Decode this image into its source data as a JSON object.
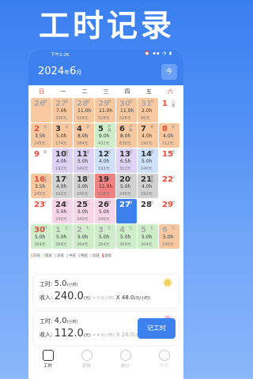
{
  "banner": "工时记录",
  "status": {
    "time": "下午2:26",
    "icons": "⏰ ▪▪ ◔ ▮"
  },
  "header": {
    "year": "2024",
    "year_suffix": "年",
    "month": "6",
    "month_suffix": "月",
    "today_button": "今"
  },
  "weekdays": [
    "日",
    "一",
    "二",
    "三",
    "四",
    "五",
    "六"
  ],
  "days": [
    {
      "d": "26",
      "l": "廿",
      "h": "",
      "w": "",
      "bg": "orange",
      "muted": true
    },
    {
      "d": "27",
      "l": "廿",
      "h": "7.0h",
      "w": "336元",
      "bg": "orange",
      "muted": true
    },
    {
      "d": "28",
      "l": "廿",
      "h": "11.0h",
      "w": "528元",
      "bg": "orange",
      "muted": true
    },
    {
      "d": "29",
      "l": "廿",
      "h": "11.0h",
      "w": "528元",
      "bg": "orange",
      "muted": true
    },
    {
      "d": "30",
      "l": "廿",
      "h": "11.0h",
      "w": "528元",
      "bg": "orange",
      "muted": true
    },
    {
      "d": "31",
      "l": "廿",
      "h": "2.0h",
      "w": "96元",
      "bg": "orange",
      "muted": true
    },
    {
      "d": "1",
      "l": "儿童",
      "h": "",
      "w": "",
      "bg": "none"
    },
    {
      "d": "2",
      "l": "廿",
      "h": "3.5h",
      "w": "245元",
      "bg": "orange"
    },
    {
      "d": "3",
      "l": "廿",
      "h": "5.0h",
      "w": "174元",
      "bg": "orange"
    },
    {
      "d": "4",
      "l": "廿",
      "h": "8.0h",
      "w": "384元",
      "bg": "orange"
    },
    {
      "d": "5",
      "l": "芒种",
      "h": "9.0h",
      "w": "432元",
      "bg": "green"
    },
    {
      "d": "6",
      "l": "芒种",
      "h": "8.0h",
      "w": "630元",
      "bg": "orange"
    },
    {
      "d": "7",
      "l": "初",
      "h": "4.0h",
      "w": "192元",
      "bg": "orange"
    },
    {
      "d": "8",
      "l": "初",
      "h": "4.0h",
      "w": "112元",
      "bg": "orange"
    },
    {
      "d": "9",
      "l": "初",
      "h": "",
      "w": "",
      "bg": "none"
    },
    {
      "d": "10",
      "l": "端午",
      "h": "4.0h",
      "w": "192元",
      "bg": "purple"
    },
    {
      "d": "11",
      "l": "初",
      "h": "5.0h",
      "w": "240元",
      "bg": "purple"
    },
    {
      "d": "12",
      "l": "初",
      "h": "4.0h",
      "w": "192元",
      "bg": "blue"
    },
    {
      "d": "13",
      "l": "初",
      "h": "6.5h",
      "w": "312元",
      "bg": "purple"
    },
    {
      "d": "14",
      "l": "初",
      "h": "5.0h",
      "w": "240元",
      "bg": "blue"
    },
    {
      "d": "15",
      "l": "初",
      "h": "",
      "w": "",
      "bg": "none"
    },
    {
      "d": "16",
      "l": "父亲",
      "h": "3.5h",
      "w": "245元",
      "bg": "orange"
    },
    {
      "d": "17",
      "l": "十",
      "h": "4.0h",
      "w": "192元",
      "bg": "gray"
    },
    {
      "d": "18",
      "l": "十",
      "h": "5.0h",
      "w": "240元",
      "bg": "gray"
    },
    {
      "d": "19",
      "l": "十",
      "h": "11.0h",
      "w": "528元",
      "bg": "red"
    },
    {
      "d": "20",
      "l": "十",
      "h": "5.0h",
      "w": "240元",
      "bg": "gray"
    },
    {
      "d": "21",
      "l": "夏至",
      "h": "4.0h",
      "w": "192元",
      "bg": "gray"
    },
    {
      "d": "22",
      "l": "十",
      "h": "",
      "w": "",
      "bg": "none"
    },
    {
      "d": "23",
      "l": "十",
      "h": "",
      "w": "",
      "bg": "none"
    },
    {
      "d": "24",
      "l": "十",
      "h": "5.0h",
      "w": "240元",
      "bg": "pink"
    },
    {
      "d": "25",
      "l": "二",
      "h": "5.0h",
      "w": "240元",
      "bg": "pink"
    },
    {
      "d": "26",
      "l": "廿",
      "h": "5.0h",
      "w": "240元",
      "bg": "pink"
    },
    {
      "d": "27",
      "l": "廿",
      "h": "",
      "w": "",
      "bg": "none",
      "selected": true
    },
    {
      "d": "28",
      "l": "廿",
      "h": "",
      "w": "",
      "bg": "none"
    },
    {
      "d": "29",
      "l": "廿",
      "h": "",
      "w": "",
      "bg": "none"
    },
    {
      "d": "30",
      "l": "廿",
      "h": "5.0h",
      "w": "264元",
      "bg": "green"
    },
    {
      "d": "1",
      "l": "七",
      "h": "5.0h",
      "w": "264元",
      "bg": "green",
      "muted": true
    },
    {
      "d": "2",
      "l": "七",
      "h": "5.0h",
      "w": "264元",
      "bg": "green",
      "muted": true
    },
    {
      "d": "3",
      "l": "七",
      "h": "5.0h",
      "w": "264元",
      "bg": "green",
      "muted": true
    },
    {
      "d": "4",
      "l": "七",
      "h": "5.0h",
      "w": "264元",
      "bg": "green",
      "muted": true
    },
    {
      "d": "5",
      "l": "七",
      "h": "5.0h",
      "w": "264元",
      "bg": "green",
      "muted": true
    },
    {
      "d": "6",
      "l": "七",
      "h": "5.0h",
      "w": "190元",
      "bg": "orange",
      "muted": true
    }
  ],
  "legend": [
    {
      "label": "白班",
      "color": "#f8c9a0"
    },
    {
      "label": "夜班",
      "color": "#cdeec9"
    },
    {
      "label": "早班",
      "color": "#ded3f4"
    },
    {
      "label": "中班",
      "color": "#cfe1fb"
    },
    {
      "label": "晚班",
      "color": "#d2d2d2"
    },
    {
      "label": "加班",
      "color": "#f8d6ea"
    },
    {
      "label": "请假",
      "color": "#f28080"
    }
  ],
  "cards": [
    {
      "hours_label": "工时:",
      "hours_value": "5.0",
      "hours_unit": "(小时)",
      "income_label": "收入:",
      "income_value": "240.0",
      "income_unit": "(元)",
      "formula_hours": "= 5.0(小时)",
      "formula_x": "X",
      "formula_rate": "48.0",
      "formula_rate_unit": "(元/小时)"
    },
    {
      "hours_label": "工时:",
      "hours_value": "4.0",
      "hours_unit": "(小时)",
      "income_label": "收入:",
      "income_value": "112.0",
      "income_unit": "(元)",
      "formula_hours": "= 4.0(小时)",
      "formula_x": "X",
      "formula_rate": "28.0",
      "formula_rate_unit": "(元/小时)"
    }
  ],
  "fab": "记工时",
  "tabs": [
    {
      "label": "工时",
      "active": true
    },
    {
      "label": "转换",
      "active": false
    },
    {
      "label": "统计",
      "active": false
    },
    {
      "label": "个人",
      "active": false
    }
  ]
}
